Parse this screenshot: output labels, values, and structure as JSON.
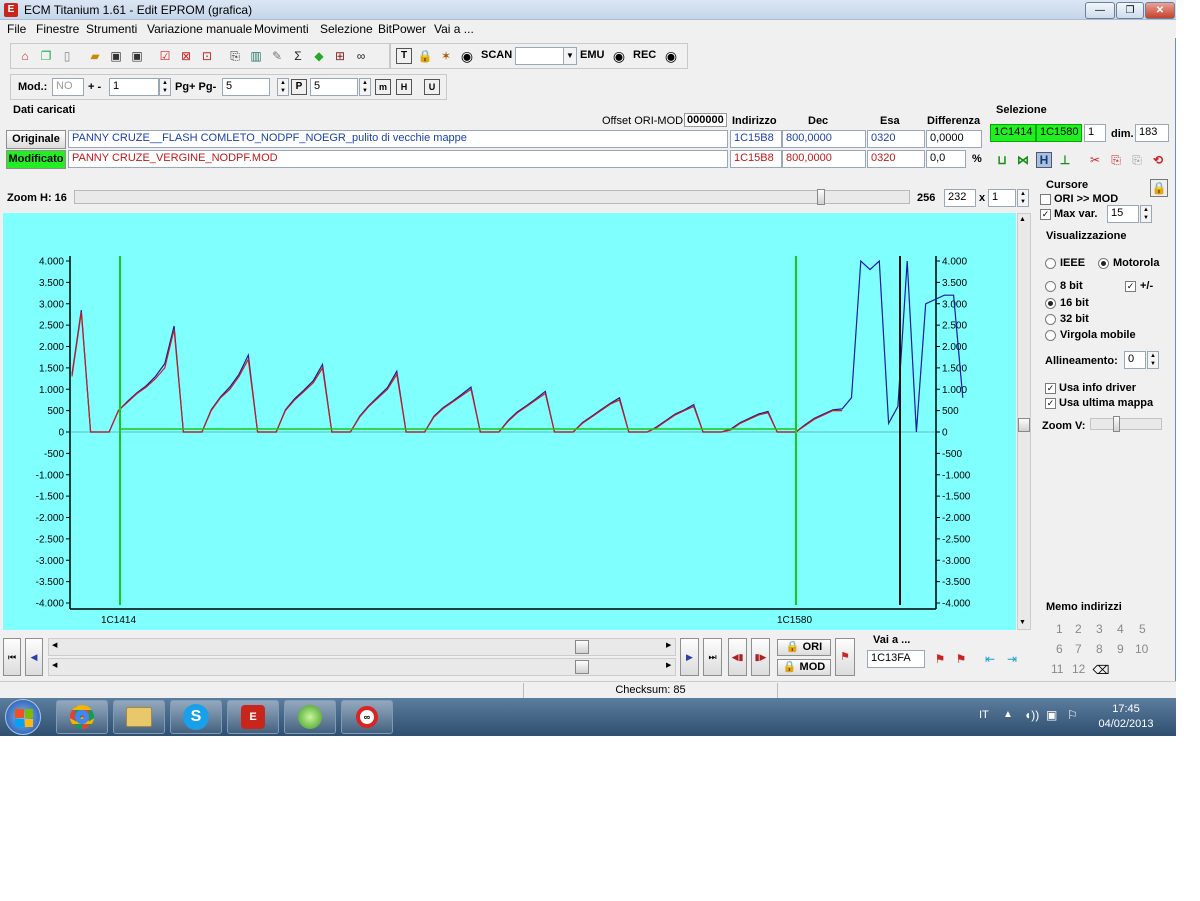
{
  "window": {
    "title": "ECM Titanium 1.61 - Edit EPROM (grafica)",
    "app_icon": "E",
    "minimize": "—",
    "maximize": "❐",
    "close": "✕"
  },
  "menu": [
    "File",
    "Finestre",
    "Strumenti",
    "Variazione manuale",
    "Movimenti",
    "Selezione",
    "BitPower",
    "Vai a ..."
  ],
  "toolbar1": {
    "scan_label": "SCAN",
    "scan_value": "",
    "emu_label": "EMU",
    "rec_label": "REC"
  },
  "toolbar2": {
    "mod_label": "Mod.:",
    "mod_value": "NO",
    "plusminus_label": "+ -",
    "plusminus_value": "1",
    "pg_label": "Pg+ Pg-",
    "pg_value": "5",
    "p_value": "5"
  },
  "data": {
    "section_title": "Dati caricati",
    "offset_label": "Offset ORI-MOD",
    "offset_value": "000000",
    "col_indirizzo": "Indirizzo",
    "col_dec": "Dec",
    "col_esa": "Esa",
    "col_diff": "Differenza",
    "original": {
      "label": "Originale",
      "file": "PANNY CRUZE__FLASH COMLETO_NODPF_NOEGR_pulito di vecchie mappe",
      "address": "1C15B8",
      "dec": "800,0000",
      "hex": "0320",
      "diff": "0,0000"
    },
    "modified": {
      "label": "Modificato",
      "file": "PANNY CRUZE_VERGINE_NODPF.MOD",
      "address": "1C15B8",
      "dec": "800,0000",
      "hex": "0320",
      "diff": "0,0",
      "diff_unit": "%"
    }
  },
  "selection": {
    "title": "Selezione",
    "start": "1C1414",
    "end": "1C1580",
    "step": "1",
    "dim_label": "dim.",
    "dim_value": "183"
  },
  "zoom": {
    "label": "Zoom H: 16",
    "value_a": "256",
    "value_b": "232",
    "x_label": "x",
    "multiplier": "1"
  },
  "cursor": {
    "title": "Cursore",
    "ori_mod_label": "ORI >> MOD",
    "ori_mod_checked": false,
    "maxvar_label": "Max var.",
    "maxvar_checked": true,
    "maxvar_value": "15"
  },
  "view": {
    "title": "Visualizzazione",
    "ieee": "IEEE",
    "motorola": "Motorola",
    "bit8": "8 bit",
    "bit16": "16 bit",
    "bit32": "32 bit",
    "float": "Virgola mobile",
    "signed_label": "+/-",
    "align_label": "Allineamento:",
    "align_value": "0",
    "driver_label": "Usa info driver",
    "lastmap_label": "Usa ultima mappa",
    "zoomv_label": "Zoom V:"
  },
  "memo": {
    "title": "Memo indirizzi",
    "items": [
      "1",
      "2",
      "3",
      "4",
      "5",
      "6",
      "7",
      "8",
      "9",
      "10",
      "11",
      "12"
    ]
  },
  "nav": {
    "ori_label": "ORI",
    "mod_label": "MOD",
    "goto_label": "Vai a ...",
    "goto_value": "1C13FA"
  },
  "status": {
    "checksum": "Checksum: 85"
  },
  "taskbar": {
    "lang": "IT",
    "time": "17:45",
    "date": "04/02/2013"
  },
  "colors": {
    "plot_bg": "#80ffff",
    "original_line": "#1a1aa0",
    "modified_line": "#c81e1e",
    "cursor_line": "#19c819",
    "selection_green": "#22ee22"
  },
  "chart_data": {
    "type": "line",
    "ylim": [
      -4000,
      4000
    ],
    "y_ticks": [
      "4.000",
      "3.500",
      "3.000",
      "2.500",
      "2.000",
      "1.500",
      "1.000",
      "500",
      "0",
      "-500",
      "-1.000",
      "-1.500",
      "-2.000",
      "-2.500",
      "-3.000",
      "-3.500",
      "-4.000"
    ],
    "x_labels": [
      "1C1414",
      "1C1580"
    ],
    "series": [
      {
        "values": [
          1300,
          2800,
          0,
          0,
          0,
          500,
          700,
          900,
          1050,
          1250,
          1500,
          2400,
          0,
          0,
          0,
          500,
          800,
          1000,
          1300,
          1700,
          0,
          0,
          0,
          500,
          750,
          950,
          1150,
          1500,
          0,
          0,
          0,
          350,
          600,
          800,
          1000,
          1350,
          0,
          0,
          0,
          350,
          550,
          700,
          850,
          1000,
          0,
          0,
          0,
          250,
          450,
          600,
          750,
          900,
          0,
          0,
          0,
          200,
          350,
          500,
          650,
          750,
          0,
          0,
          0,
          100,
          250,
          400,
          500,
          600,
          0,
          0,
          0,
          50,
          200,
          300,
          400,
          450,
          0,
          0,
          0,
          150,
          300,
          400,
          500,
          500
        ]
      },
      {
        "values": [
          1350,
          2850,
          0,
          0,
          0,
          500,
          720,
          920,
          1080,
          1300,
          1600,
          2480,
          0,
          0,
          0,
          520,
          820,
          1050,
          1350,
          1800,
          0,
          0,
          0,
          520,
          780,
          980,
          1200,
          1580,
          0,
          0,
          0,
          370,
          620,
          830,
          1040,
          1420,
          0,
          0,
          0,
          370,
          570,
          720,
          880,
          1050,
          0,
          0,
          0,
          270,
          470,
          620,
          780,
          950,
          0,
          0,
          0,
          220,
          370,
          520,
          670,
          800,
          0,
          0,
          0,
          120,
          270,
          420,
          520,
          640,
          0,
          0,
          0,
          70,
          220,
          320,
          420,
          480,
          0,
          0,
          0,
          170,
          320,
          420,
          520,
          540,
          800,
          4000,
          3800,
          4000,
          200,
          600,
          4000,
          0,
          3000,
          3100,
          3200,
          3200,
          800
        ]
      }
    ]
  }
}
